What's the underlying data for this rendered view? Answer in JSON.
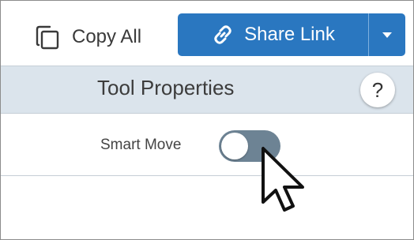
{
  "toolbar": {
    "copy_all": {
      "label": "Copy All",
      "icon": "copy-icon"
    },
    "share_link": {
      "label": "Share Link",
      "icon": "link-icon",
      "dropdown_icon": "caret-down-icon"
    }
  },
  "panel": {
    "title": "Tool Properties",
    "help_label": "?"
  },
  "properties": {
    "smart_move": {
      "label": "Smart Move",
      "enabled": false
    }
  },
  "colors": {
    "accent": "#2a77c0",
    "header_bg": "#dbe4ec",
    "toggle_track": "#6d8394"
  }
}
